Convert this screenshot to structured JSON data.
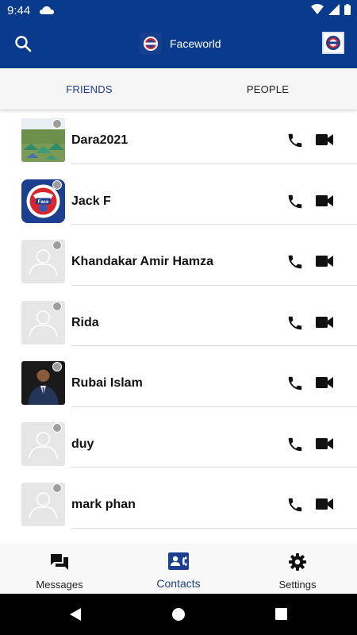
{
  "status_bar": {
    "time": "9:44"
  },
  "app_bar": {
    "title": "Faceworld"
  },
  "tabs": [
    {
      "label": "FRIENDS"
    },
    {
      "label": "PEOPLE"
    }
  ],
  "contacts": [
    {
      "name": "Dara2021"
    },
    {
      "name": "Jack F"
    },
    {
      "name": "Khandakar Amir Hamza"
    },
    {
      "name": "Rida"
    },
    {
      "name": "Rubai Islam"
    },
    {
      "name": "duy"
    },
    {
      "name": "mark phan"
    }
  ],
  "bottom_nav": [
    {
      "label": "Messages"
    },
    {
      "label": "Contacts"
    },
    {
      "label": "Settings"
    }
  ],
  "colors": {
    "primary": "#0a3a8c",
    "active_tab": "#1c3f8f",
    "presence_offline": "#9e9e9e"
  },
  "icons": [
    "search-icon",
    "faceworld-logo-icon",
    "profile-icon",
    "phone-icon",
    "video-camera-icon",
    "messages-icon",
    "contacts-icon",
    "settings-gear-icon",
    "back-icon",
    "home-icon",
    "recents-icon"
  ]
}
